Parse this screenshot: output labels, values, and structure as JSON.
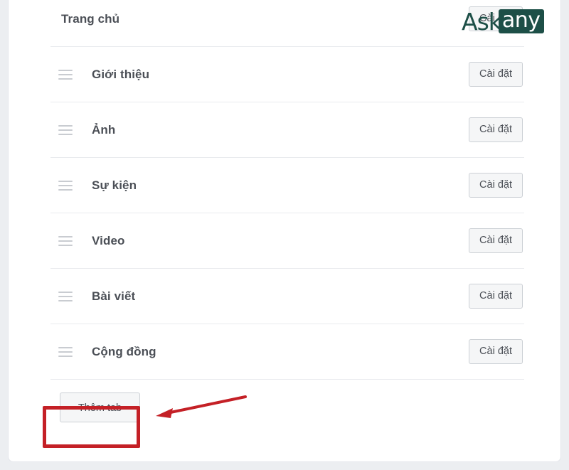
{
  "page": {
    "background_color": "#eceef1",
    "card_background": "#ffffff"
  },
  "tabs": {
    "rows": [
      {
        "label": "Trang chủ",
        "has_drag_handle": false,
        "settings_label": "Cài đặt"
      },
      {
        "label": "Giới thiệu",
        "has_drag_handle": true,
        "settings_label": "Cài đặt"
      },
      {
        "label": "Ảnh",
        "has_drag_handle": true,
        "settings_label": "Cài đặt"
      },
      {
        "label": "Sự kiện",
        "has_drag_handle": true,
        "settings_label": "Cài đặt"
      },
      {
        "label": "Video",
        "has_drag_handle": true,
        "settings_label": "Cài đặt"
      },
      {
        "label": "Bài viết",
        "has_drag_handle": true,
        "settings_label": "Cài đặt"
      },
      {
        "label": "Cộng đồng",
        "has_drag_handle": true,
        "settings_label": "Cài đặt"
      }
    ],
    "add_tab_label": "Thêm tab"
  },
  "annotation": {
    "color": "#c42026",
    "highlight_target": "Thêm tab"
  },
  "watermark": {
    "part1": "Ask",
    "part2": "any",
    "color": "#1d4f47"
  }
}
